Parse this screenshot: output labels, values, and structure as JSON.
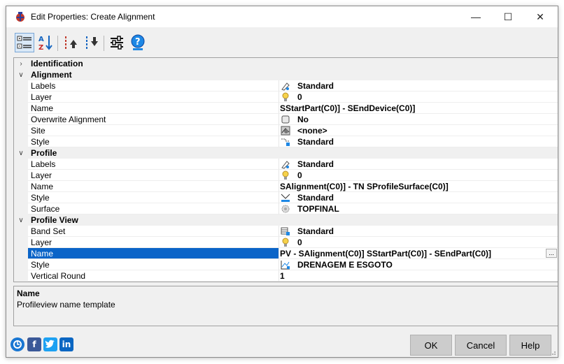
{
  "window": {
    "title": "Edit Properties: Create Alignment",
    "controls": {
      "minimize": "—",
      "maximize": "☐",
      "close": "✕"
    }
  },
  "toolbar": {
    "buttons": [
      "categorized-view",
      "sort-alphabetical",
      "move-up",
      "move-down",
      "settings",
      "help"
    ]
  },
  "grid": {
    "categories": {
      "identification": "Identification",
      "alignment": "Alignment",
      "profile": "Profile",
      "profile_view": "Profile View"
    },
    "alignment": {
      "labels": {
        "name": "Labels",
        "value": "Standard"
      },
      "layer": {
        "name": "Layer",
        "value": "0"
      },
      "name": {
        "name": "Name",
        "value": "SStartPart(C0)] - SEndDevice(C0)]"
      },
      "overwrite": {
        "name": "Overwrite Alignment",
        "value": "No"
      },
      "site": {
        "name": "Site",
        "value": "<none>"
      },
      "style": {
        "name": "Style",
        "value": "Standard"
      }
    },
    "profile": {
      "labels": {
        "name": "Labels",
        "value": "Standard"
      },
      "layer": {
        "name": "Layer",
        "value": "0"
      },
      "name": {
        "name": "Name",
        "value": "SAlignment(C0)] - TN SProfileSurface(C0)]"
      },
      "style": {
        "name": "Style",
        "value": "Standard"
      },
      "surface": {
        "name": "Surface",
        "value": "TOPFINAL"
      }
    },
    "profile_view": {
      "band_set": {
        "name": "Band Set",
        "value": "Standard"
      },
      "layer": {
        "name": "Layer",
        "value": "0"
      },
      "name": {
        "name": "Name",
        "value": "PV - SAlignment(C0)] SStartPart(C0)] - SEndPart(C0)]",
        "ellipsis": "..."
      },
      "style": {
        "name": "Style",
        "value": "DRENAGEM E ESGOTO"
      },
      "vertical_round": {
        "name": "Vertical Round",
        "value": "1"
      }
    }
  },
  "description": {
    "title": "Name",
    "text": "Profileview name template"
  },
  "buttons": {
    "ok": "OK",
    "cancel": "Cancel",
    "help": "Help"
  },
  "colors": {
    "selection": "#0a64c8",
    "button": "#cccccc",
    "panel": "#f0f0f0"
  }
}
